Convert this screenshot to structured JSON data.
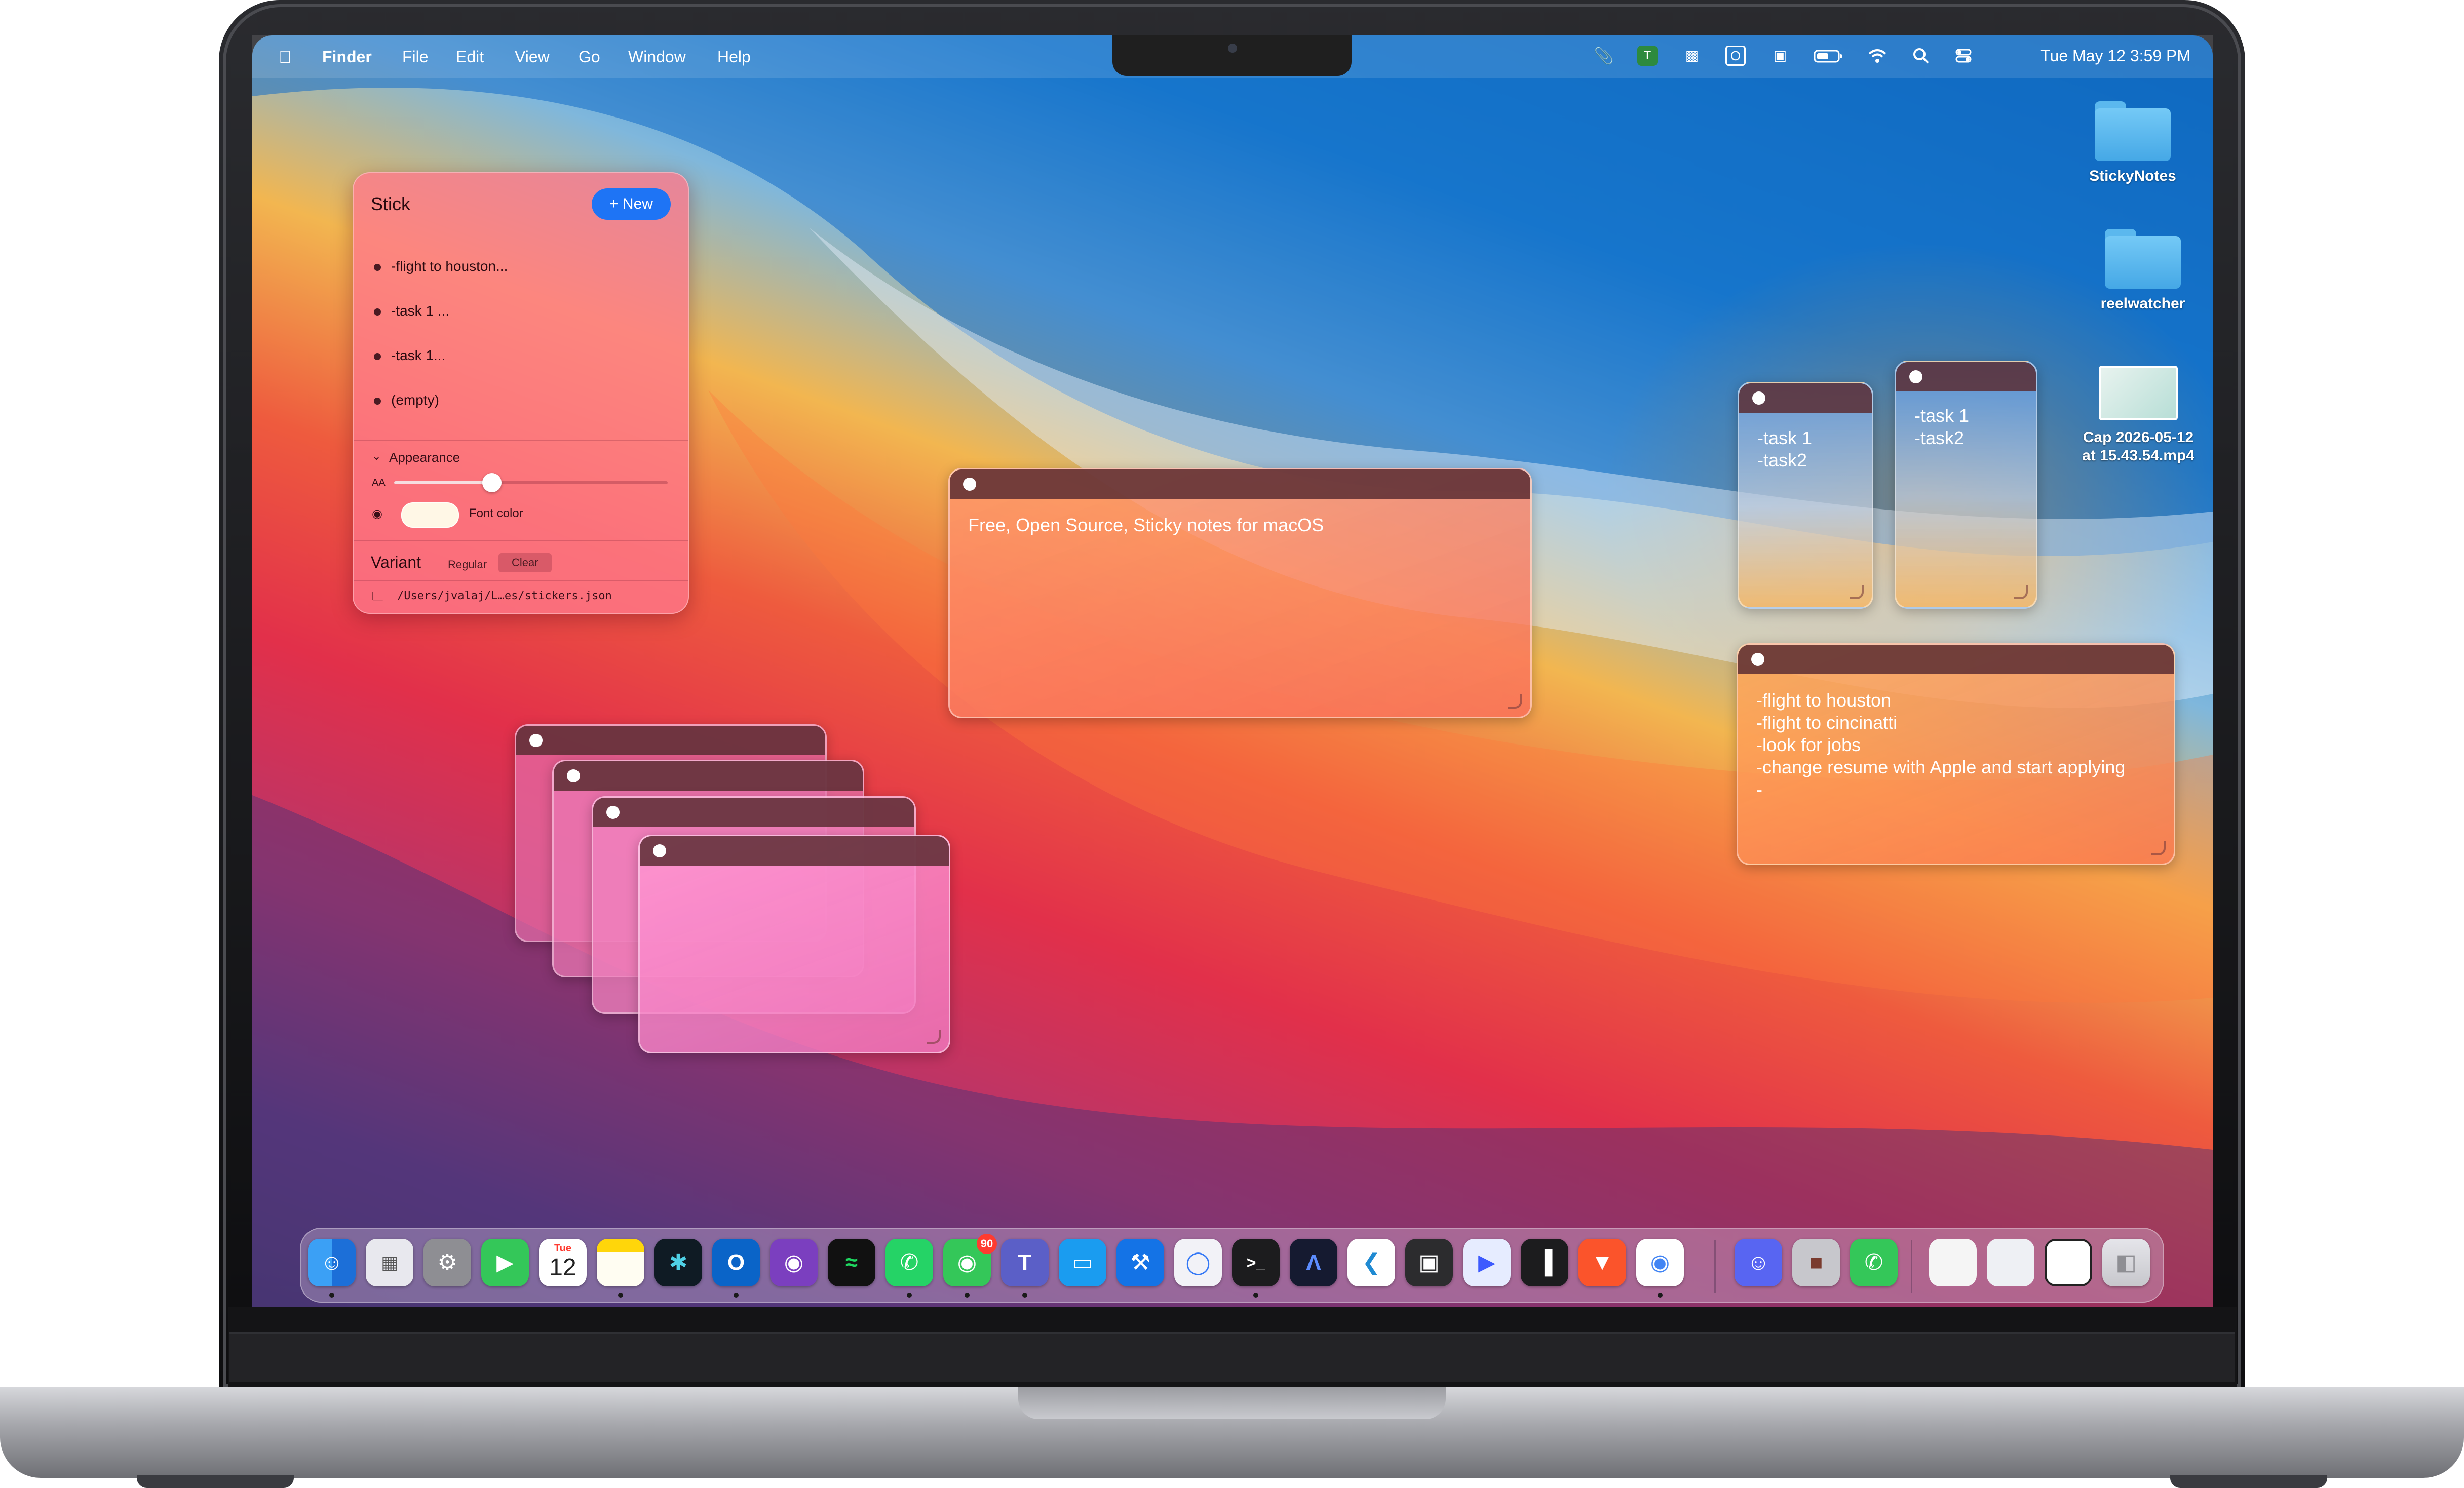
{
  "menubar": {
    "apple_icon": "",
    "app_name": "Finder",
    "items": [
      "File",
      "Edit",
      "View",
      "Go",
      "Window",
      "Help"
    ],
    "clock": "Tue May 12  3:59 PM",
    "tray_icons": [
      "paperclip-icon",
      "teams-icon",
      "clapper-icon",
      "outlook-icon",
      "display-icon",
      "battery-icon",
      "wifi-icon",
      "search-icon",
      "control-center-icon"
    ]
  },
  "stick_panel": {
    "title": "Stick",
    "new_button": "+ New",
    "notes": [
      "-flight to houston...",
      "-task 1 ...",
      "-task 1...",
      "(empty)"
    ],
    "appearance_label": "Appearance",
    "font_size_label": "AA",
    "font_size_level": 0.35,
    "font_color_label": "Font color",
    "font_color": "#fff7e6",
    "variant_label": "Variant",
    "variant_options": [
      "Regular",
      "Clear"
    ],
    "variant_selected": "Clear",
    "path": "/Users/jvalaj/L…es/stickers.json"
  },
  "stickies": {
    "main_note": "Free, Open Source, Sticky notes for macOS",
    "task_note_a": "-task 1\n-task2",
    "task_note_b": "-task 1\n-task2",
    "travel_note": "-flight to houston\n-flight to cincinatti\n-look for jobs\n-change resume with Apple and start applying\n-"
  },
  "desktop_icons": {
    "folder1": "StickyNotes",
    "folder2": "reelwatcher",
    "video_file_line1": "Cap 2026-05-12",
    "video_file_line2": "at 15.43.54.mp4"
  },
  "dock": {
    "calendar_month": "Tue",
    "calendar_day": "12",
    "messages_badge": "90",
    "apps": [
      "finder-icon",
      "launchpad-icon",
      "settings-icon",
      "facetime-icon",
      "calendar-icon",
      "notes-icon",
      "copilot-icon",
      "outlook-icon",
      "github-icon",
      "spotify-icon",
      "whatsapp-icon",
      "messages-icon",
      "teams-icon",
      "simulator-icon",
      "xcode-icon",
      "safari-icon",
      "terminal-icon",
      "arc-icon",
      "vscode-icon",
      "blocks-icon",
      "screen-icon",
      "stats-icon",
      "brave-icon",
      "chrome-icon",
      "discord-icon",
      "contacts-icon",
      "phone-icon",
      "recent1-icon",
      "recent2-icon",
      "recent3-icon",
      "trash-icon"
    ]
  },
  "colors": {
    "accent": "#1e74f5",
    "panel": "#ff7a8c",
    "sticky_bar": "#5a2d32"
  }
}
